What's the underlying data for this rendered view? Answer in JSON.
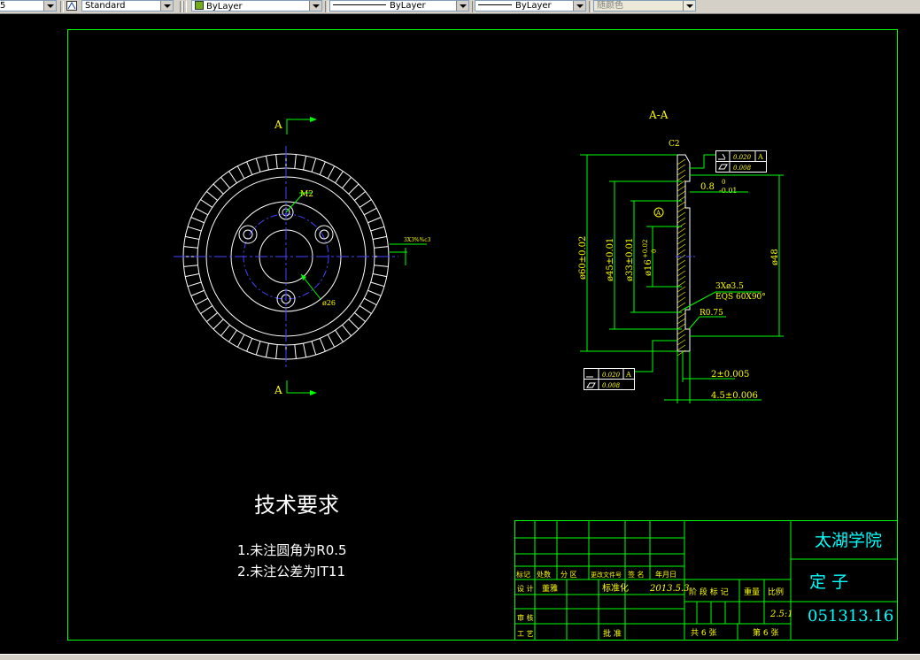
{
  "toolbar": {
    "left_fragment": "5",
    "text_style": "Standard",
    "layer": "ByLayer",
    "linetype": "ByLayer",
    "lineweight": "ByLayer",
    "color": "随颜色"
  },
  "colors": {
    "frame": "#00ff00",
    "geometry": "#ffffff",
    "dimension": "#ffff00",
    "center_line": "#4444ff",
    "title_text": "#00ffff",
    "background": "#000000"
  },
  "front_view": {
    "section_label_top": "A",
    "section_label_bottom": "A",
    "dim_thread": "M2",
    "dim_pcd": "ø26",
    "dim_right_note": "3X3%%c3"
  },
  "section_view": {
    "title": "A-A",
    "chamfer": "C2",
    "dim_outer": "ø60±0.02",
    "dim_d45": "ø45±0.01",
    "dim_d33": "ø33±0.01",
    "dim_d16_base": "ø16",
    "dim_d16_upper": "+0.02",
    "dim_d16_lower": "0",
    "dim_right_dia": "ø48",
    "dim_step": "0.8",
    "dim_step_upper": "0",
    "dim_step_lower": "-0.01",
    "note_holes": "3Xø3.5",
    "note_eqs": "EQS 60X90°",
    "radius": "R0.75",
    "thick_inner": "2±0.005",
    "thick_total": "4.5±0.006",
    "datum_label": "A",
    "tol_flat_top": "0.020",
    "tol_par_top": "0.008",
    "tol_ref_top": "A",
    "tol_flat_bottom": "0.020",
    "tol_par_bottom": "0.008",
    "tol_ref_bottom": "A"
  },
  "tech_requirements": {
    "heading": "技术要求",
    "item1": "1.未注圆角为R0.5",
    "item2": "2.未注公差为IT11"
  },
  "title_block": {
    "school": "太湖学院",
    "part_name": "定 子",
    "drawing_no": "051313.16",
    "h_mark": "标记",
    "h_count": "处数",
    "h_zone": "分 区",
    "h_docno": "更改文件号",
    "h_sign": "签 名",
    "h_date": "年月日",
    "l_design": "设 计",
    "designer": "董雅",
    "l_standard": "标准化",
    "design_date": "2013.5.3",
    "l_stage": "阶 段 标 记",
    "l_weight": "重量",
    "l_scale": "比例",
    "scale": "2.5:1",
    "l_check": "审 核",
    "l_process": "工 艺",
    "l_approve": "批 准",
    "sheets_total": "共 6 张",
    "sheet_no": "第 6 张"
  }
}
